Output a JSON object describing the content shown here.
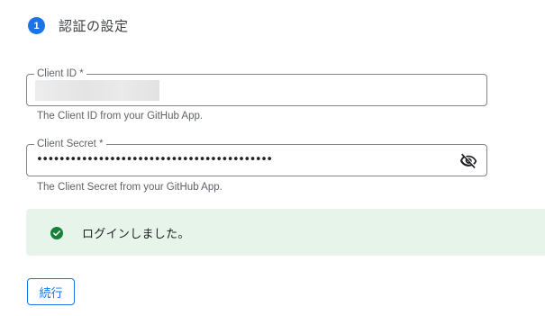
{
  "step": {
    "number": "1",
    "title": "認証の設定"
  },
  "fields": {
    "client_id": {
      "label": "Client ID *",
      "helper": "The Client ID from your GitHub App."
    },
    "client_secret": {
      "label": "Client Secret *",
      "value": "••••••••••••••••••••••••••••••••••••••••••",
      "helper": "The Client Secret from your GitHub App.",
      "toggle_icon": "eye-off-icon"
    }
  },
  "banner": {
    "text": "ログインしました。",
    "icon": "check-circle-icon",
    "color": "#188038",
    "background": "#e6f4ea"
  },
  "actions": {
    "continue_label": "続行"
  },
  "colors": {
    "accent": "#1a73e8"
  }
}
